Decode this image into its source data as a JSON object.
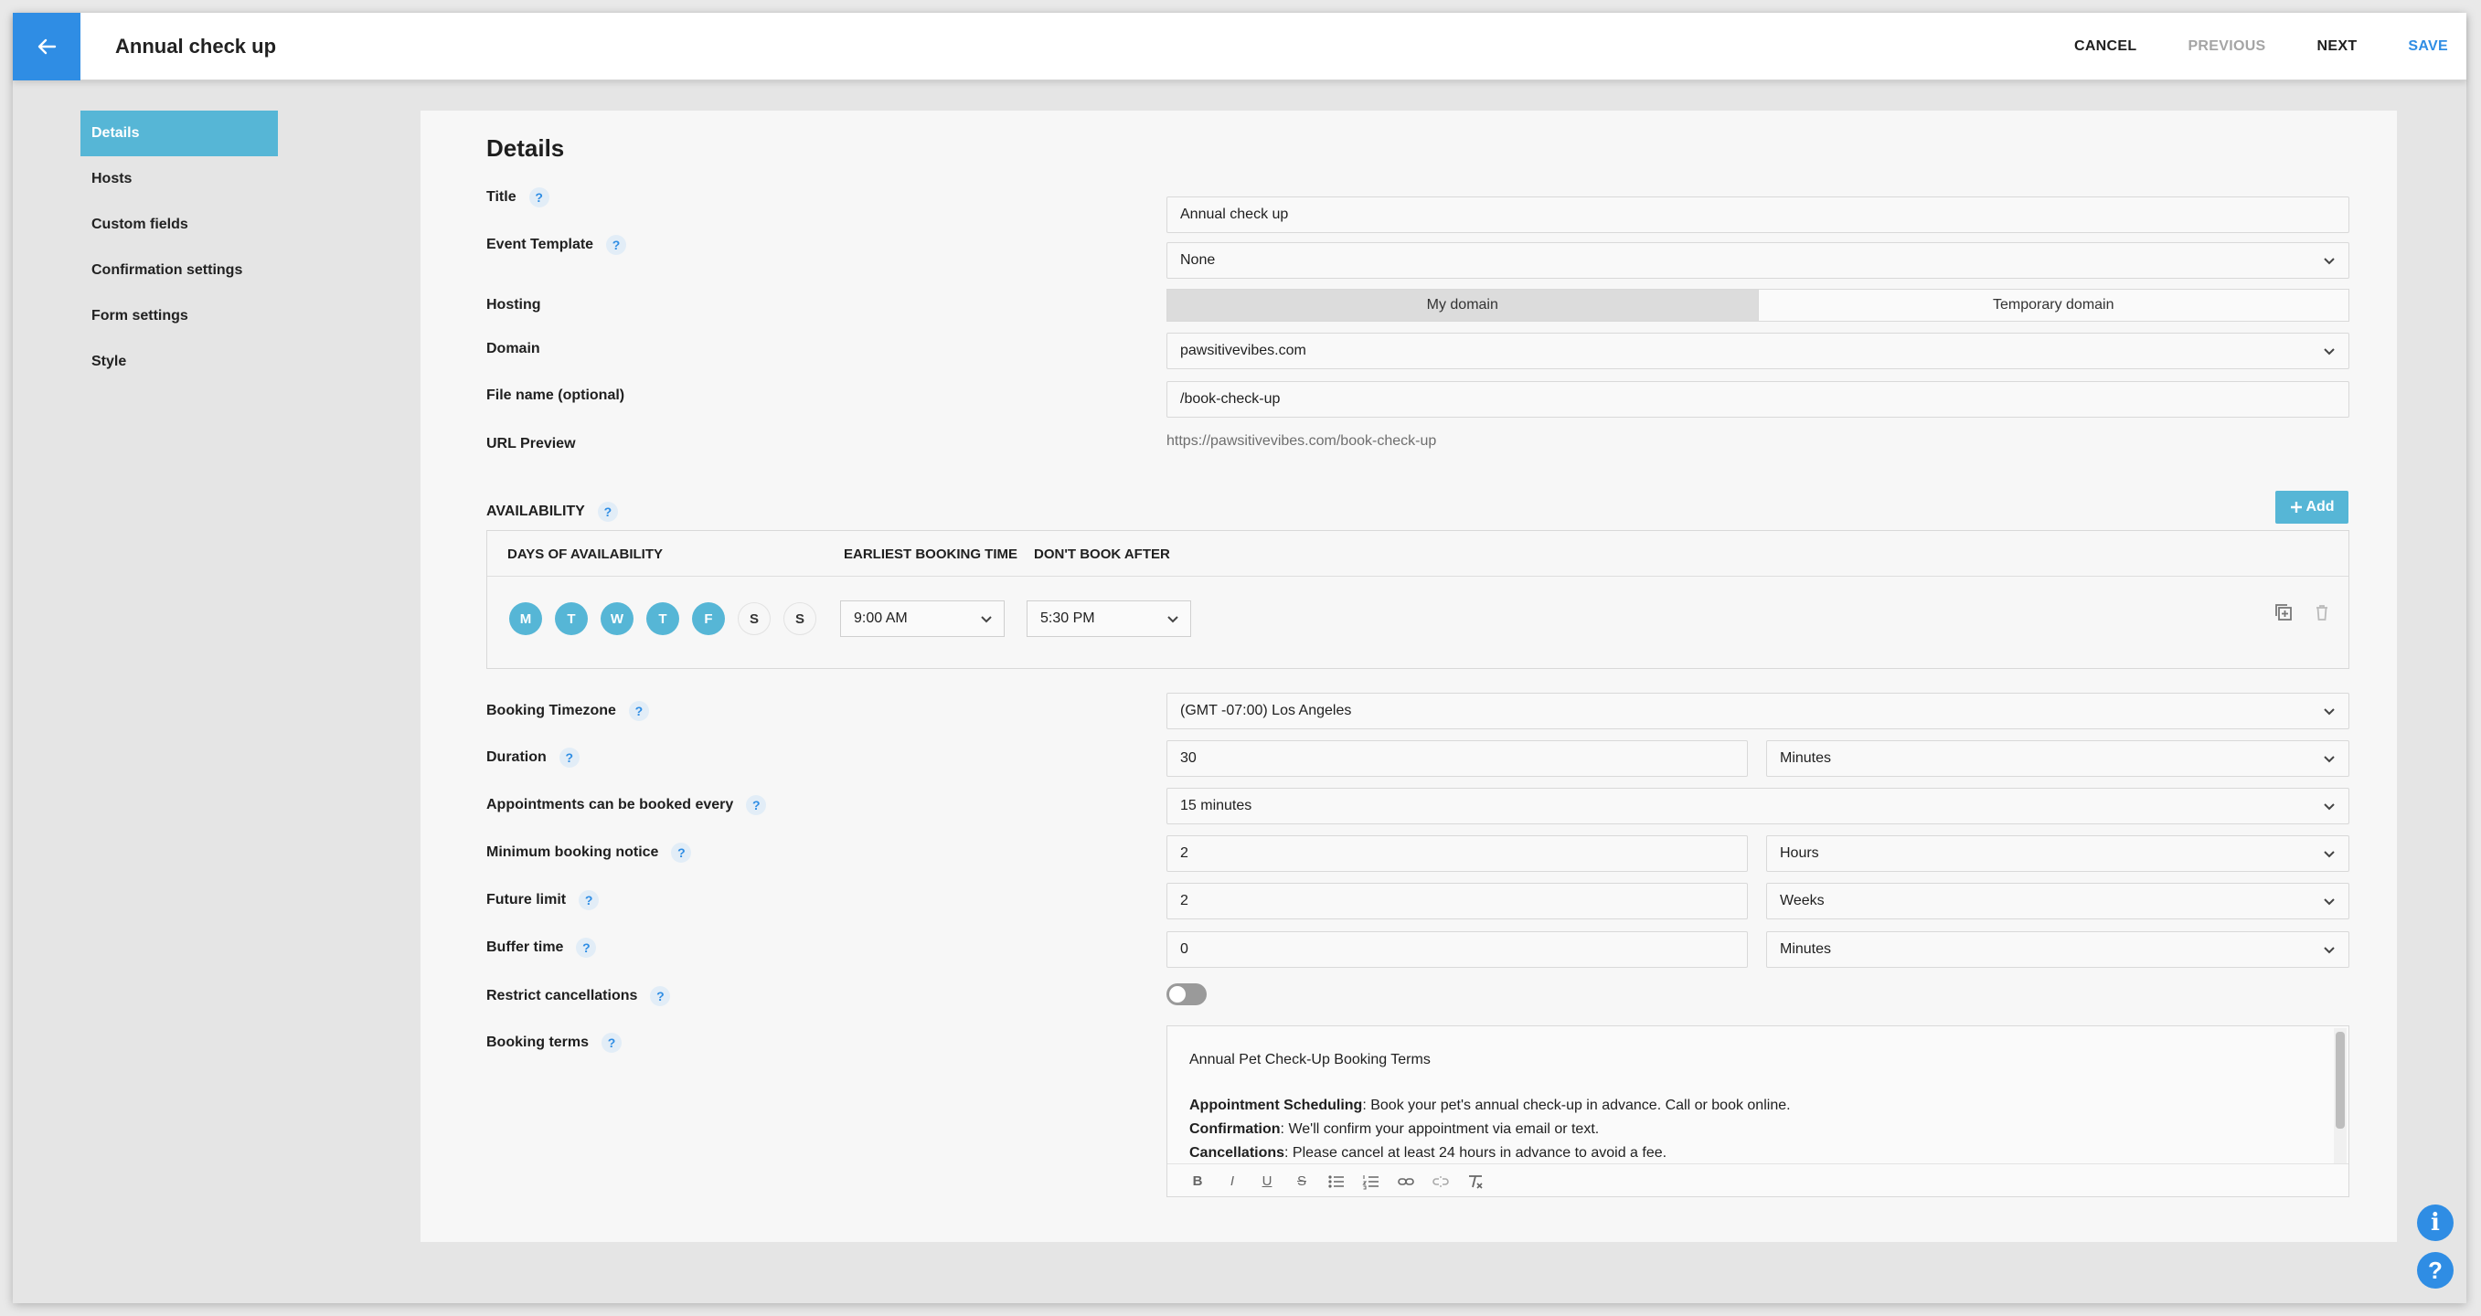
{
  "header": {
    "title": "Annual check up",
    "cancel": "CANCEL",
    "previous": "PREVIOUS",
    "next": "NEXT",
    "save": "SAVE"
  },
  "sidebar": {
    "items": [
      {
        "label": "Details",
        "active": true
      },
      {
        "label": "Hosts"
      },
      {
        "label": "Custom fields"
      },
      {
        "label": "Confirmation settings"
      },
      {
        "label": "Form settings"
      },
      {
        "label": "Style"
      }
    ]
  },
  "details": {
    "heading": "Details",
    "title_label": "Title",
    "title_value": "Annual check up",
    "event_template_label": "Event Template",
    "event_template_value": "None",
    "hosting_label": "Hosting",
    "hosting_options": [
      "My domain",
      "Temporary domain"
    ],
    "hosting_selected": "My domain",
    "domain_label": "Domain",
    "domain_value": "pawsitivevibes.com",
    "file_name_label": "File name (optional)",
    "file_name_value": "/book-check-up",
    "url_preview_label": "URL Preview",
    "url_preview_value": "https://pawsitivevibes.com/book-check-up"
  },
  "availability": {
    "label": "AVAILABILITY",
    "add_label": "Add",
    "col_days": "DAYS OF AVAILABILITY",
    "col_earliest": "EARLIEST BOOKING TIME",
    "col_dont_book": "DON'T BOOK AFTER",
    "days": [
      {
        "letter": "M",
        "on": true
      },
      {
        "letter": "T",
        "on": true
      },
      {
        "letter": "W",
        "on": true
      },
      {
        "letter": "T",
        "on": true
      },
      {
        "letter": "F",
        "on": true
      },
      {
        "letter": "S",
        "on": false
      },
      {
        "letter": "S",
        "on": false
      }
    ],
    "earliest": "9:00 AM",
    "dont_book_after": "5:30 PM"
  },
  "settings": {
    "timezone_label": "Booking Timezone",
    "timezone_value": "(GMT -07:00) Los Angeles",
    "duration_label": "Duration",
    "duration_value": "30",
    "duration_unit": "Minutes",
    "interval_label": "Appointments can be booked every",
    "interval_value": "15 minutes",
    "min_notice_label": "Minimum booking notice",
    "min_notice_value": "2",
    "min_notice_unit": "Hours",
    "future_limit_label": "Future limit",
    "future_limit_value": "2",
    "future_limit_unit": "Weeks",
    "buffer_label": "Buffer time",
    "buffer_value": "0",
    "buffer_unit": "Minutes",
    "restrict_label": "Restrict cancellations",
    "restrict_on": false,
    "terms_label": "Booking terms"
  },
  "terms": {
    "title": "Annual Pet Check-Up Booking Terms",
    "scheduling_bold": "Appointment Scheduling",
    "scheduling_text": ": Book your pet's annual check-up in advance. Call or book online.",
    "confirmation_bold": "Confirmation",
    "confirmation_text": ": We'll confirm your appointment via email or text.",
    "cancellations_bold": "Cancellations",
    "cancellations_text": ": Please cancel at least 24 hours in advance to avoid a fee."
  },
  "toolbar": {
    "bold": "B",
    "italic": "I",
    "underline": "U",
    "strike": "S"
  },
  "colors": {
    "accent_blue": "#2f8de4",
    "accent_teal": "#56b6d6"
  },
  "fabs": {
    "info": "i",
    "help": "?"
  }
}
